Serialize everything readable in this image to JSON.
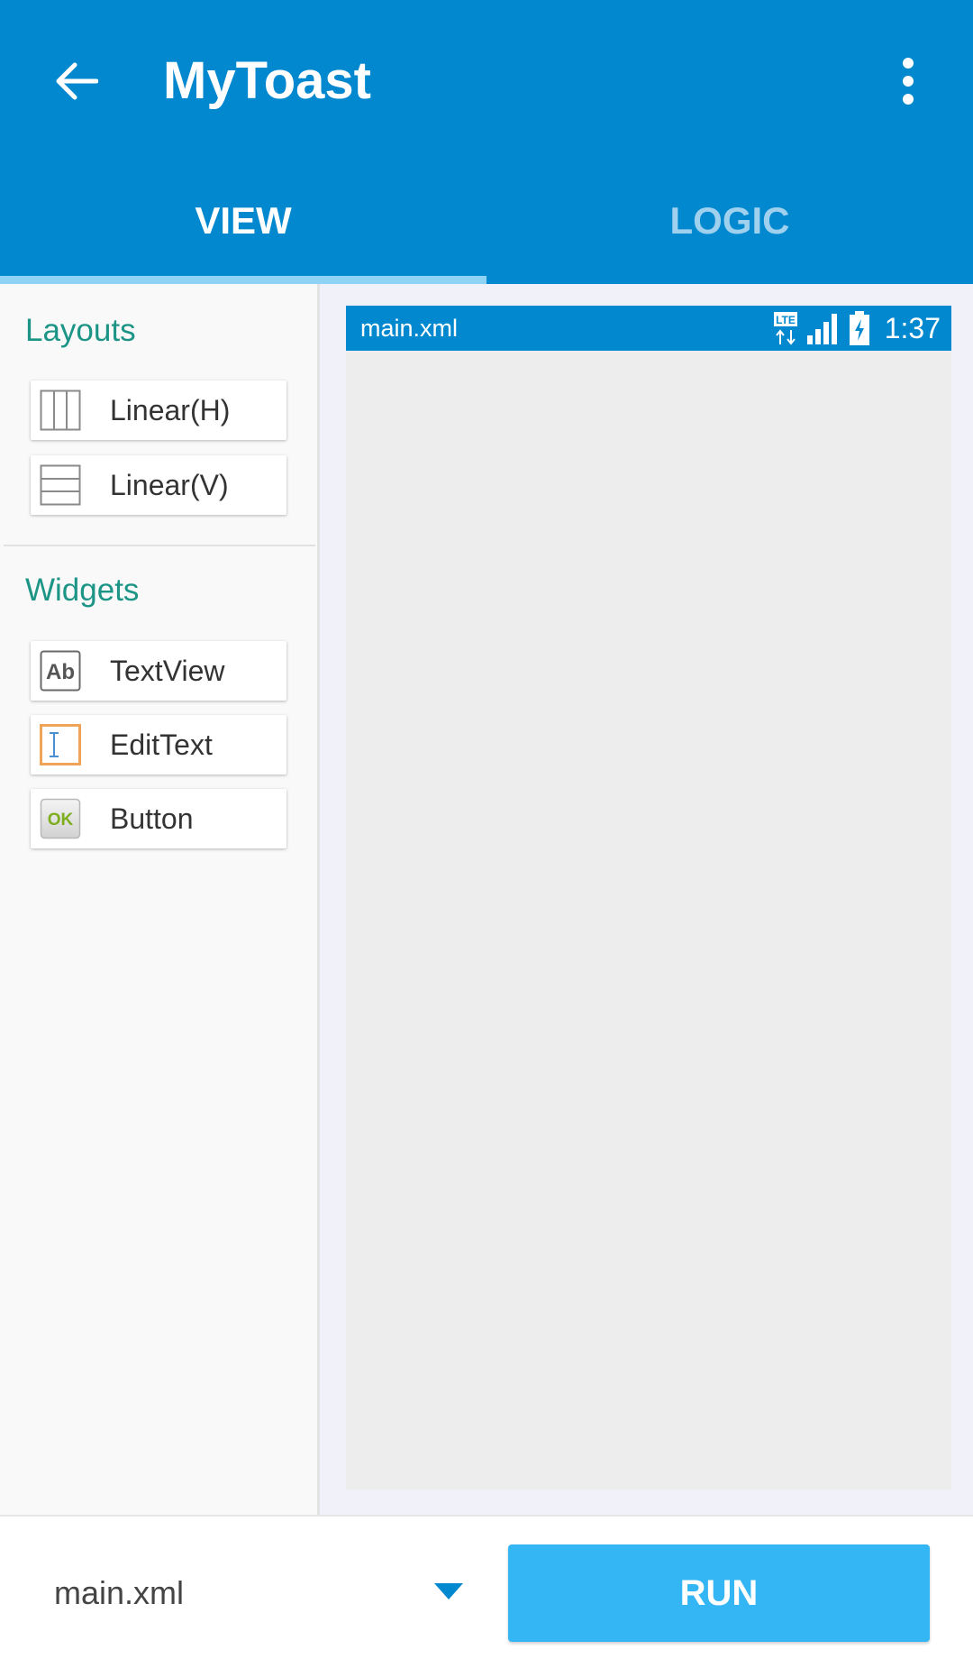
{
  "app": {
    "title": "MyToast"
  },
  "icons": {
    "back": "back-arrow-icon",
    "more": "more-vert-icon",
    "linear_h": "linear-horizontal-icon",
    "linear_v": "linear-vertical-icon",
    "textview": "textview-icon",
    "edittext": "edittext-icon",
    "button": "button-widget-icon",
    "dropdown": "dropdown-arrow-icon"
  },
  "tabs": [
    {
      "label": "VIEW",
      "active": true
    },
    {
      "label": "LOGIC",
      "active": false
    }
  ],
  "palette": {
    "layouts_title": "Layouts",
    "layouts": [
      {
        "label": "Linear(H)"
      },
      {
        "label": "Linear(V)"
      }
    ],
    "widgets_title": "Widgets",
    "widgets": [
      {
        "label": "TextView",
        "icon_text": "Ab"
      },
      {
        "label": "EditText"
      },
      {
        "label": "Button",
        "icon_text": "OK"
      }
    ]
  },
  "canvas": {
    "filename": "main.xml",
    "status": {
      "network": "LTE",
      "time": "1:37"
    }
  },
  "bottom": {
    "file_selected": "main.xml",
    "run_label": "RUN"
  },
  "colors": {
    "primary": "#0288cf",
    "accent": "#33b6f3",
    "section_title": "#1c9587",
    "tab_inactive": "#9fd1ef"
  }
}
